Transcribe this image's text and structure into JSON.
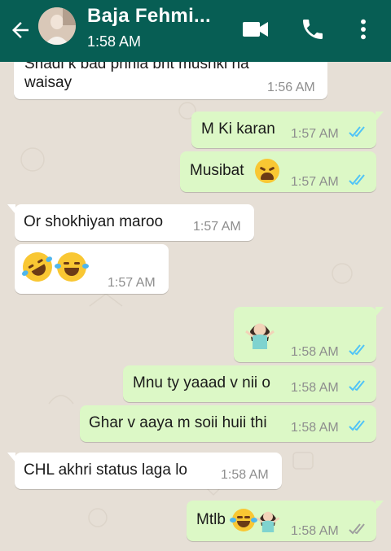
{
  "header": {
    "title": "Baja Fehmi...",
    "subtitle": "1:58 AM",
    "icons": [
      "back-arrow-icon",
      "video-call-icon",
      "phone-icon",
      "more-vert-icon"
    ],
    "color": "#075e54"
  },
  "messages": [
    {
      "dir": "in",
      "line1": "Shadi k bad phhla bht mushkl ha",
      "line2": "waisay",
      "time": "1:56 AM"
    },
    {
      "dir": "out",
      "text": "M Ki karan",
      "time": "1:57 AM",
      "ticks": "read"
    },
    {
      "dir": "out",
      "text": "Musibat",
      "emoji": "tired-face-emoji",
      "time": "1:57 AM",
      "ticks": "read"
    },
    {
      "dir": "in",
      "text": "Or shokhiyan maroo",
      "time": "1:57 AM"
    },
    {
      "dir": "in",
      "emoji": [
        "rolling-on-floor-laughing-emoji",
        "laughing-tears-emoji"
      ],
      "time": "1:57 AM"
    },
    {
      "dir": "out",
      "emoji": "person-shrugging-emoji",
      "time": "1:58 AM",
      "ticks": "read"
    },
    {
      "dir": "out",
      "text": "Mnu ty yaaad v nii o",
      "time": "1:58 AM",
      "ticks": "read"
    },
    {
      "dir": "out",
      "text": "Ghar v aaya m soii huii thi",
      "time": "1:58 AM",
      "ticks": "read"
    },
    {
      "dir": "in",
      "text": "CHL akhri status laga lo",
      "time": "1:58 AM"
    },
    {
      "dir": "out",
      "text": "Mtlb",
      "emoji": [
        "laughing-tears-emoji",
        "person-shrugging-emoji"
      ],
      "time": "1:58 AM",
      "ticks": "delivered"
    }
  ],
  "colors": {
    "outgoing": "#dcf8c6",
    "incoming": "#ffffff",
    "read_ticks": "#4fc3f7",
    "delivered_ticks": "#9e9e9e"
  }
}
